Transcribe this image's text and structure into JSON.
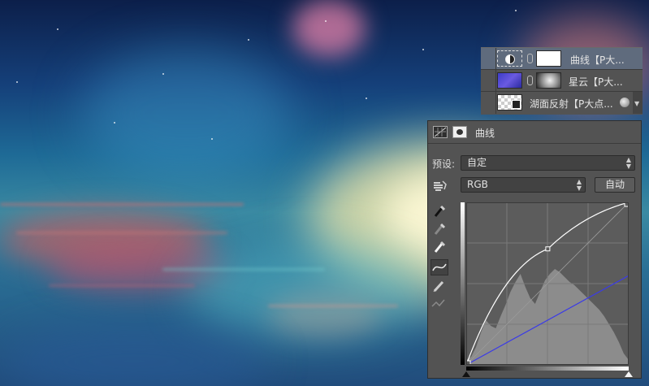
{
  "layers": [
    {
      "name": "曲线【P大...",
      "selected": true,
      "thumb": "curves-adjustment-icon",
      "mask": "white-mask"
    },
    {
      "name": "星云【P大...",
      "selected": false,
      "thumb": "nebula-thumbnail",
      "mask": "grey-mask"
    },
    {
      "name": "湖面反射【P大点...",
      "selected": false,
      "thumb": "transparent-thumbnail",
      "mask": ""
    }
  ],
  "properties": {
    "title": "曲线",
    "preset_label": "预设:",
    "preset_value": "自定",
    "channel_value": "RGB",
    "auto_button": "自动"
  },
  "colors": {
    "panel_bg": "#535353",
    "selected_layer": "#5f6b7d",
    "curve_rgb": "#ffffff",
    "curve_blue": "#3a3ae8",
    "histogram": "#8c8c8c"
  },
  "curves": {
    "input_range": [
      0,
      255
    ],
    "output_range": [
      0,
      255
    ],
    "rgb_points": [
      [
        0,
        0
      ],
      [
        128,
        182
      ],
      [
        255,
        255
      ]
    ],
    "blue_points": [
      [
        0,
        0
      ],
      [
        255,
        140
      ]
    ]
  }
}
